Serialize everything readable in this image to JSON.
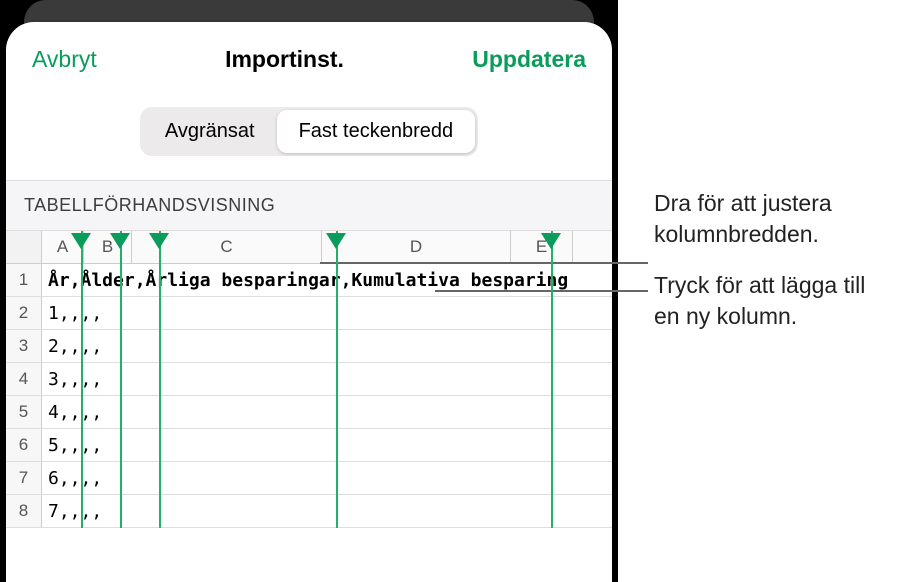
{
  "header": {
    "cancel": "Avbryt",
    "title": "Importinst.",
    "update": "Uppdatera"
  },
  "segmented": {
    "delimited": "Avgränsat",
    "fixed": "Fast teckenbredd",
    "selected": "fixed"
  },
  "section_label": "TABELLFÖRHANDSVISNING",
  "columns": {
    "widths": [
      39,
      42,
      48,
      190,
      189,
      62
    ],
    "labels": [
      "A",
      "B",
      "C",
      "D",
      "E"
    ],
    "handle_positions": [
      75,
      114,
      153,
      330,
      545
    ]
  },
  "rows": [
    {
      "n": "1",
      "text": "År,Ålder,Årliga besparingar,Kumulativa besparing",
      "bold": true
    },
    {
      "n": "2",
      "text": "1,,,,"
    },
    {
      "n": "3",
      "text": "2,,,,"
    },
    {
      "n": "4",
      "text": "3,,,,"
    },
    {
      "n": "5",
      "text": "4,,,,"
    },
    {
      "n": "6",
      "text": "5,,,,"
    },
    {
      "n": "7",
      "text": "6,,,,"
    },
    {
      "n": "8",
      "text": "7,,,,"
    }
  ],
  "annotations": {
    "drag": "Dra för att justera kolumnbredden.",
    "tap": "Tryck för att lägga till en ny kolumn."
  },
  "colors": {
    "accent": "#0a9c5b"
  }
}
